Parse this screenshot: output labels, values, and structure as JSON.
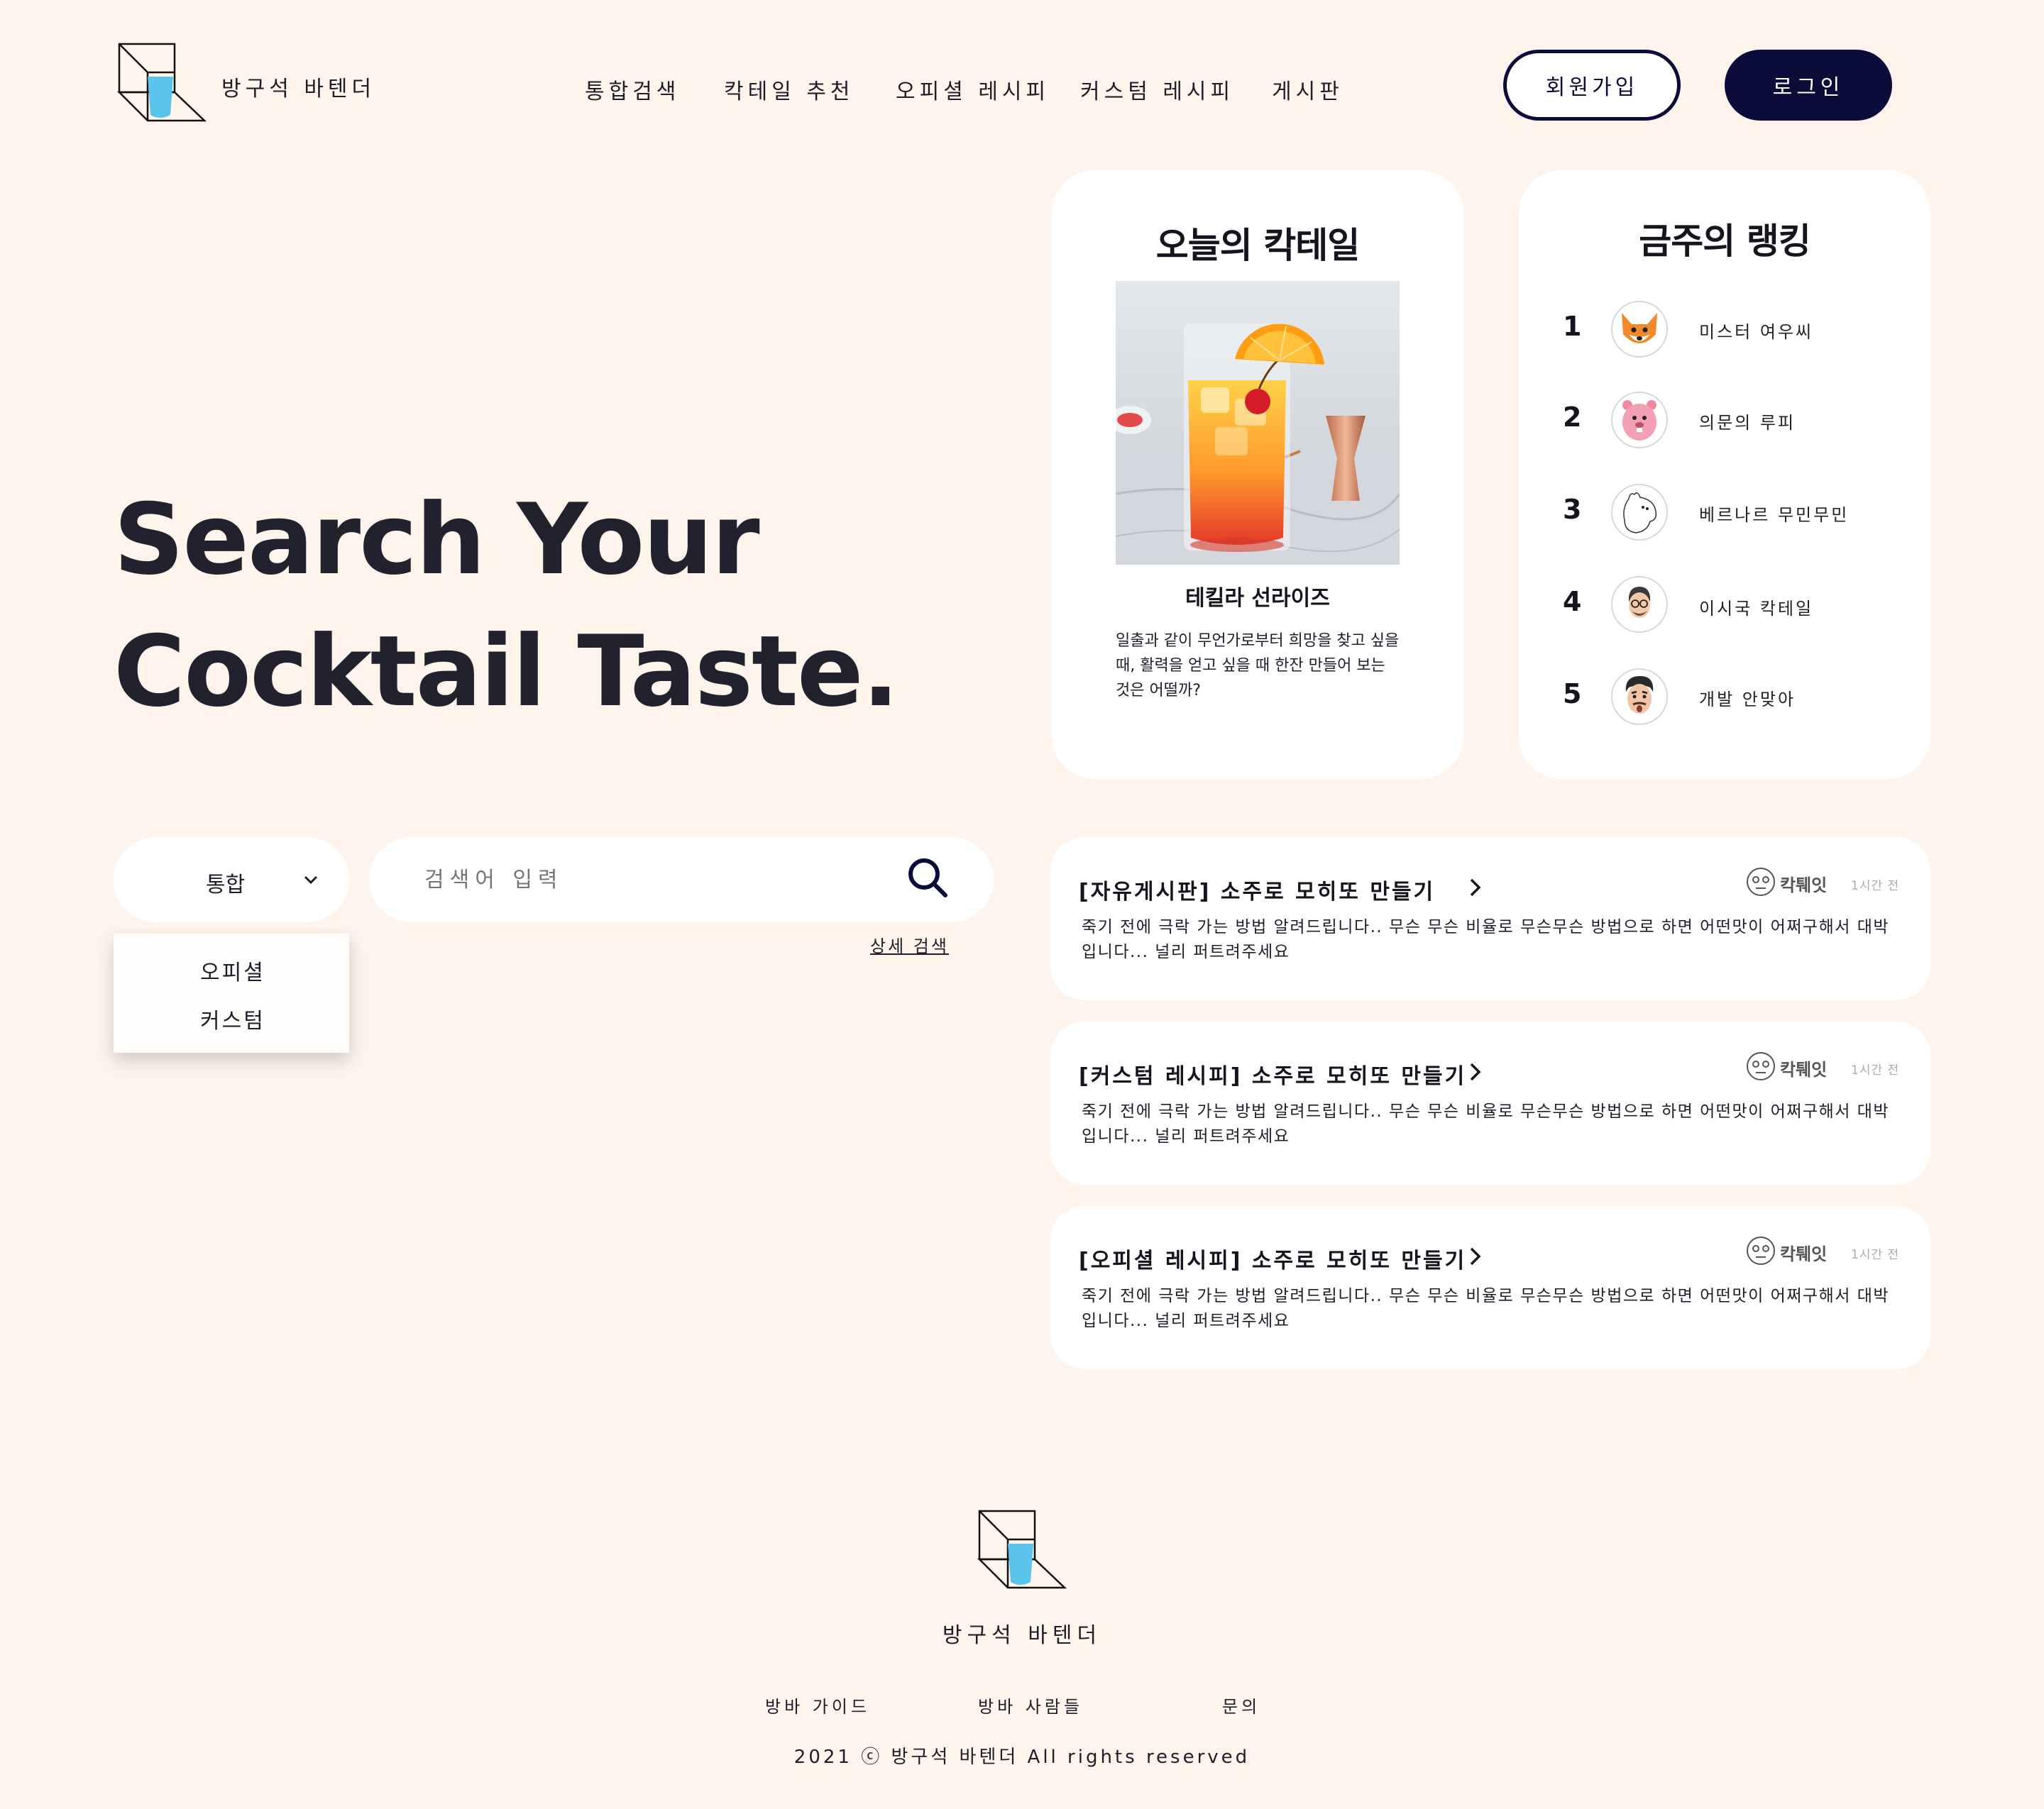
{
  "header": {
    "brand": "방구석 바텐더",
    "nav": [
      "통합검색",
      "칵테일 추천",
      "오피셜 레시피",
      "커스텀 레시피",
      "게시판"
    ],
    "signup_label": "회원가입",
    "login_label": "로그인"
  },
  "hero": {
    "line1": "Search Your",
    "line2": "Cocktail Taste."
  },
  "today": {
    "title": "오늘의 칵테일",
    "cocktail_name": "테킬라 선라이즈",
    "description": "일출과 같이 무언가로부터 희망을 찾고 싶을 때, 활력을 얻고 싶을 때 한잔 만들어 보는 것은 어떨까?"
  },
  "ranking": {
    "title": "금주의 랭킹",
    "items": [
      {
        "rank": "1",
        "name": "미스터 여우씨",
        "avatar": "fox-avatar"
      },
      {
        "rank": "2",
        "name": "의문의 루피",
        "avatar": "pink-beaver-avatar"
      },
      {
        "rank": "3",
        "name": "베르나르 무민무민",
        "avatar": "moomin-avatar"
      },
      {
        "rank": "4",
        "name": "이시국 칵테일",
        "avatar": "glasses-man-avatar"
      },
      {
        "rank": "5",
        "name": "개발 안맞아",
        "avatar": "memoji-avatar"
      }
    ]
  },
  "search": {
    "select_value": "통합",
    "placeholder": "검색어 입력",
    "detail_link": "상세 검색",
    "dropdown_options": [
      "오피셜",
      "커스텀"
    ]
  },
  "posts": [
    {
      "title": "[자유게시판] 소주로 모히또 만들기",
      "author": "칵퉤잇",
      "time": "1시간 전",
      "body": "죽기 전에 극락 가는 방법 알려드립니다.. 무슨 무슨 비율로 무슨무슨 방법으로 하면 어떤맛이 어쩌구해서 대박입니다... 널리 퍼트려주세요"
    },
    {
      "title": "[커스텀 레시피] 소주로 모히또 만들기",
      "author": "칵퉤잇",
      "time": "1시간 전",
      "body": "죽기 전에 극락 가는 방법 알려드립니다.. 무슨 무슨 비율로 무슨무슨 방법으로 하면 어떤맛이 어쩌구해서 대박입니다... 널리 퍼트려주세요"
    },
    {
      "title": "[오피셜 레시피] 소주로 모히또 만들기",
      "author": "칵퉤잇",
      "time": "1시간 전",
      "body": "죽기 전에 극락 가는 방법 알려드립니다.. 무슨 무슨 비율로 무슨무슨 방법으로 하면 어떤맛이 어쩌구해서 대박입니다... 널리 퍼트려주세요"
    }
  ],
  "footer": {
    "brand": "방구석 바텐더",
    "links": [
      "방바 가이드",
      "방바 사람들",
      "문의"
    ],
    "copyright": "2021 ⓒ 방구석 바텐더 All rights reserved"
  },
  "colors": {
    "background": "#fef4ec",
    "primary": "#0c0c3a",
    "accent_glass": "#5bc4ec"
  }
}
